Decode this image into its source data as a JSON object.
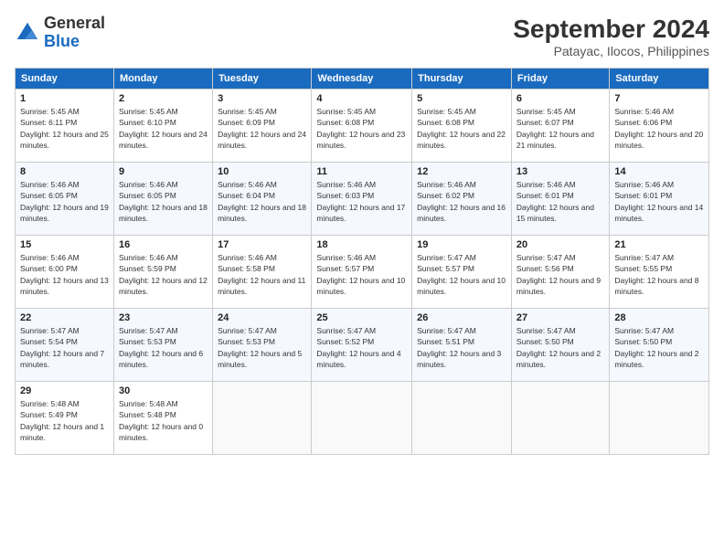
{
  "header": {
    "logo_general": "General",
    "logo_blue": "Blue",
    "month_year": "September 2024",
    "location": "Patayac, Ilocos, Philippines"
  },
  "weekdays": [
    "Sunday",
    "Monday",
    "Tuesday",
    "Wednesday",
    "Thursday",
    "Friday",
    "Saturday"
  ],
  "weeks": [
    [
      {
        "day": "1",
        "sunrise": "5:45 AM",
        "sunset": "6:11 PM",
        "daylight": "12 hours and 25 minutes."
      },
      {
        "day": "2",
        "sunrise": "5:45 AM",
        "sunset": "6:10 PM",
        "daylight": "12 hours and 24 minutes."
      },
      {
        "day": "3",
        "sunrise": "5:45 AM",
        "sunset": "6:09 PM",
        "daylight": "12 hours and 24 minutes."
      },
      {
        "day": "4",
        "sunrise": "5:45 AM",
        "sunset": "6:08 PM",
        "daylight": "12 hours and 23 minutes."
      },
      {
        "day": "5",
        "sunrise": "5:45 AM",
        "sunset": "6:08 PM",
        "daylight": "12 hours and 22 minutes."
      },
      {
        "day": "6",
        "sunrise": "5:45 AM",
        "sunset": "6:07 PM",
        "daylight": "12 hours and 21 minutes."
      },
      {
        "day": "7",
        "sunrise": "5:46 AM",
        "sunset": "6:06 PM",
        "daylight": "12 hours and 20 minutes."
      }
    ],
    [
      {
        "day": "8",
        "sunrise": "5:46 AM",
        "sunset": "6:05 PM",
        "daylight": "12 hours and 19 minutes."
      },
      {
        "day": "9",
        "sunrise": "5:46 AM",
        "sunset": "6:05 PM",
        "daylight": "12 hours and 18 minutes."
      },
      {
        "day": "10",
        "sunrise": "5:46 AM",
        "sunset": "6:04 PM",
        "daylight": "12 hours and 18 minutes."
      },
      {
        "day": "11",
        "sunrise": "5:46 AM",
        "sunset": "6:03 PM",
        "daylight": "12 hours and 17 minutes."
      },
      {
        "day": "12",
        "sunrise": "5:46 AM",
        "sunset": "6:02 PM",
        "daylight": "12 hours and 16 minutes."
      },
      {
        "day": "13",
        "sunrise": "5:46 AM",
        "sunset": "6:01 PM",
        "daylight": "12 hours and 15 minutes."
      },
      {
        "day": "14",
        "sunrise": "5:46 AM",
        "sunset": "6:01 PM",
        "daylight": "12 hours and 14 minutes."
      }
    ],
    [
      {
        "day": "15",
        "sunrise": "5:46 AM",
        "sunset": "6:00 PM",
        "daylight": "12 hours and 13 minutes."
      },
      {
        "day": "16",
        "sunrise": "5:46 AM",
        "sunset": "5:59 PM",
        "daylight": "12 hours and 12 minutes."
      },
      {
        "day": "17",
        "sunrise": "5:46 AM",
        "sunset": "5:58 PM",
        "daylight": "12 hours and 11 minutes."
      },
      {
        "day": "18",
        "sunrise": "5:46 AM",
        "sunset": "5:57 PM",
        "daylight": "12 hours and 10 minutes."
      },
      {
        "day": "19",
        "sunrise": "5:47 AM",
        "sunset": "5:57 PM",
        "daylight": "12 hours and 10 minutes."
      },
      {
        "day": "20",
        "sunrise": "5:47 AM",
        "sunset": "5:56 PM",
        "daylight": "12 hours and 9 minutes."
      },
      {
        "day": "21",
        "sunrise": "5:47 AM",
        "sunset": "5:55 PM",
        "daylight": "12 hours and 8 minutes."
      }
    ],
    [
      {
        "day": "22",
        "sunrise": "5:47 AM",
        "sunset": "5:54 PM",
        "daylight": "12 hours and 7 minutes."
      },
      {
        "day": "23",
        "sunrise": "5:47 AM",
        "sunset": "5:53 PM",
        "daylight": "12 hours and 6 minutes."
      },
      {
        "day": "24",
        "sunrise": "5:47 AM",
        "sunset": "5:53 PM",
        "daylight": "12 hours and 5 minutes."
      },
      {
        "day": "25",
        "sunrise": "5:47 AM",
        "sunset": "5:52 PM",
        "daylight": "12 hours and 4 minutes."
      },
      {
        "day": "26",
        "sunrise": "5:47 AM",
        "sunset": "5:51 PM",
        "daylight": "12 hours and 3 minutes."
      },
      {
        "day": "27",
        "sunrise": "5:47 AM",
        "sunset": "5:50 PM",
        "daylight": "12 hours and 2 minutes."
      },
      {
        "day": "28",
        "sunrise": "5:47 AM",
        "sunset": "5:50 PM",
        "daylight": "12 hours and 2 minutes."
      }
    ],
    [
      {
        "day": "29",
        "sunrise": "5:48 AM",
        "sunset": "5:49 PM",
        "daylight": "12 hours and 1 minute."
      },
      {
        "day": "30",
        "sunrise": "5:48 AM",
        "sunset": "5:48 PM",
        "daylight": "12 hours and 0 minutes."
      },
      null,
      null,
      null,
      null,
      null
    ]
  ]
}
